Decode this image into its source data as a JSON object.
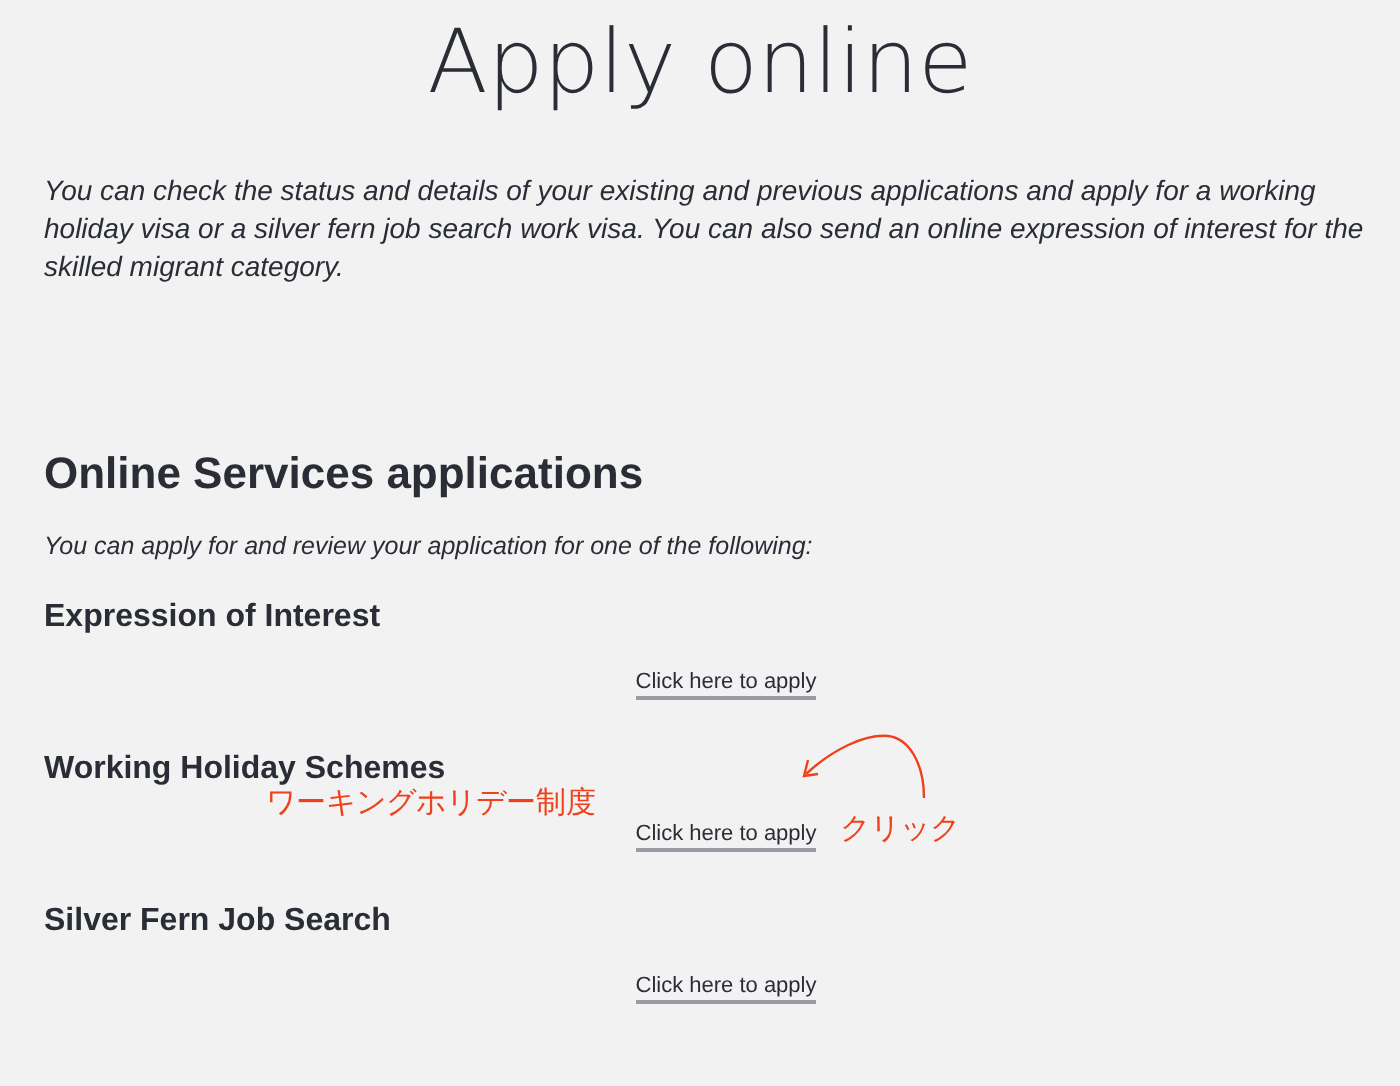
{
  "title": "Apply online",
  "intro": "You can check the status and details of your existing and previous applications and apply for a working holiday visa or a silver fern job search work visa. You can also send an online expression of interest for the skilled migrant category.",
  "heading": "Online Services applications",
  "subtitle": "You can apply for and review your application for one of the following:",
  "sections": [
    {
      "title": "Expression of Interest",
      "link": "Click here to apply"
    },
    {
      "title": "Working Holiday Schemes",
      "link": "Click here to apply",
      "annotation": {
        "label": "ワーキングホリデー制度",
        "callout": "クリック"
      }
    },
    {
      "title": "Silver Fern Job Search",
      "link": "Click here to apply"
    }
  ]
}
